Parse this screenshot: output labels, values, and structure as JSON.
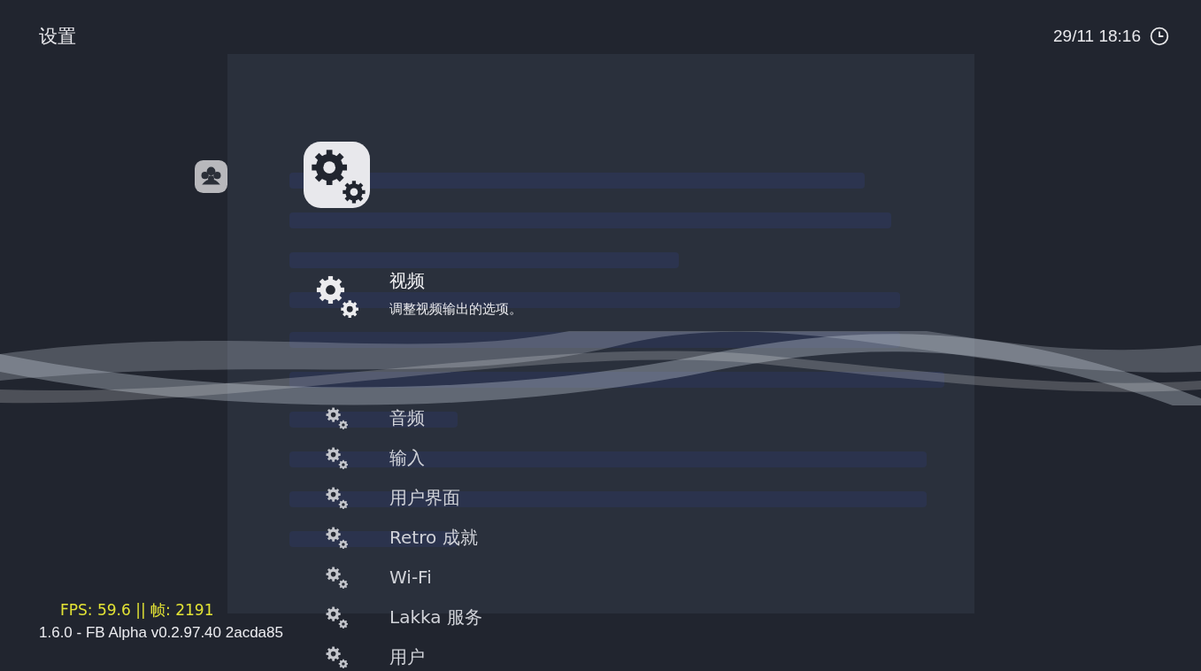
{
  "header": {
    "title": "设置",
    "clock": "29/11 18:16"
  },
  "categories": [
    {
      "kind": "users",
      "selected": false
    },
    {
      "kind": "settings",
      "selected": true
    }
  ],
  "menu": [
    {
      "label": "视频",
      "sublabel": "调整视频输出的选项。",
      "selected": true
    },
    {
      "label": "音频",
      "selected": false
    },
    {
      "label": "输入",
      "selected": false
    },
    {
      "label": "用户界面",
      "selected": false
    },
    {
      "label": "Retro 成就",
      "selected": false
    },
    {
      "label": "Wi-Fi",
      "selected": false
    },
    {
      "label": "Lakka 服务",
      "selected": false
    },
    {
      "label": "用户",
      "selected": false
    }
  ],
  "footer": {
    "version": "1.6.0 - FB Alpha v0.2.97.40 2acda85",
    "fps": "FPS: 59.6 || 帧: 2191"
  }
}
